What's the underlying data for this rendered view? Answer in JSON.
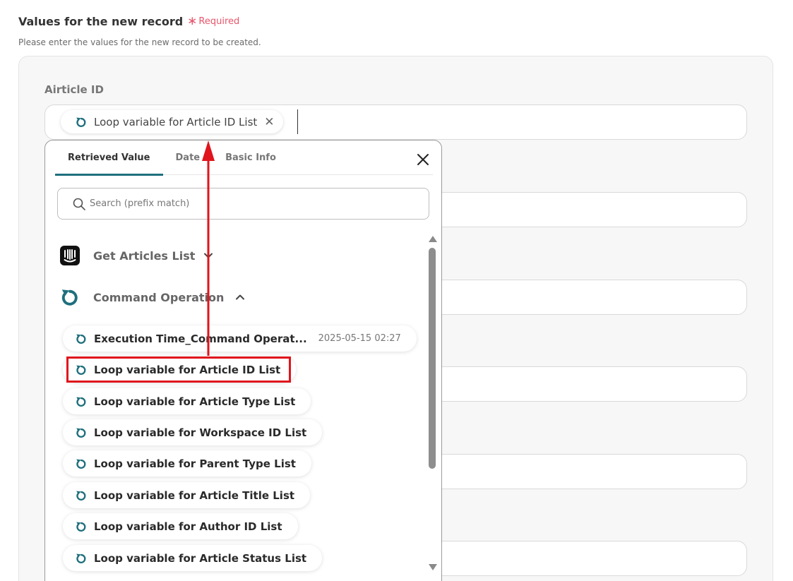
{
  "section": {
    "title": "Values for the new record",
    "required": "Required",
    "description": "Please enter the values for the new record to be created."
  },
  "field": {
    "label": "Airticle ID",
    "chip_label": "Loop variable for Article ID List"
  },
  "dropdown": {
    "tabs": [
      "Retrieved Value",
      "Date",
      "Basic Info"
    ],
    "active_tab": "Retrieved Value",
    "search_placeholder": "Search (prefix match)",
    "groups": [
      {
        "label": "Get Articles List",
        "expanded": false,
        "icon": "intercom-icon"
      },
      {
        "label": "Command Operation",
        "expanded": true,
        "icon": "loop-icon"
      }
    ],
    "items": [
      {
        "label": "Execution Time_Command Operat...",
        "timestamp": "2025-05-15 02:27"
      },
      {
        "label": "Loop variable for Article ID List",
        "highlighted": true
      },
      {
        "label": "Loop variable for Article Type List"
      },
      {
        "label": "Loop variable for Workspace ID List"
      },
      {
        "label": "Loop variable for Parent Type List"
      },
      {
        "label": "Loop variable for Article Title List"
      },
      {
        "label": "Loop variable for Author ID List"
      },
      {
        "label": "Loop variable for Article Status List"
      }
    ]
  },
  "colors": {
    "accent": "#1e6f7d",
    "required": "#e8566c",
    "annotation": "#e0141c"
  }
}
